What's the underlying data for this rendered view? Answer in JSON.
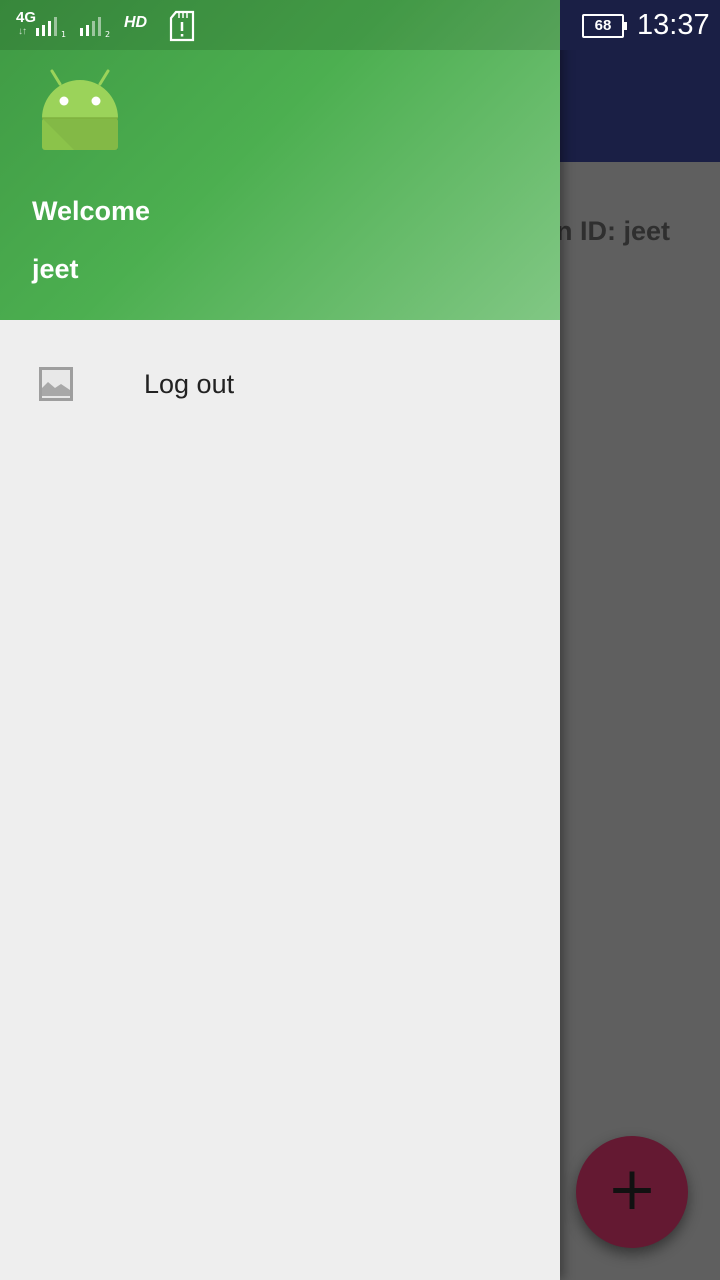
{
  "status_bar": {
    "network": "4G",
    "hd": "HD",
    "battery": "68",
    "time": "13:37",
    "icons": [
      "signal-sim1-icon",
      "signal-sim2-icon",
      "sd-card-alert-icon",
      "battery-icon"
    ]
  },
  "background_app": {
    "content_text": "n ID: jeet",
    "fab": {
      "label": "+",
      "icon": "add-icon",
      "color": "#641932"
    },
    "toolbar_color": "#1a1f45"
  },
  "drawer": {
    "header": {
      "avatar_icon": "android-logo-icon",
      "welcome": "Welcome",
      "username": "jeet",
      "color": "#4caf50"
    },
    "menu": [
      {
        "label": "Log out",
        "icon": "image-placeholder-icon"
      }
    ]
  }
}
